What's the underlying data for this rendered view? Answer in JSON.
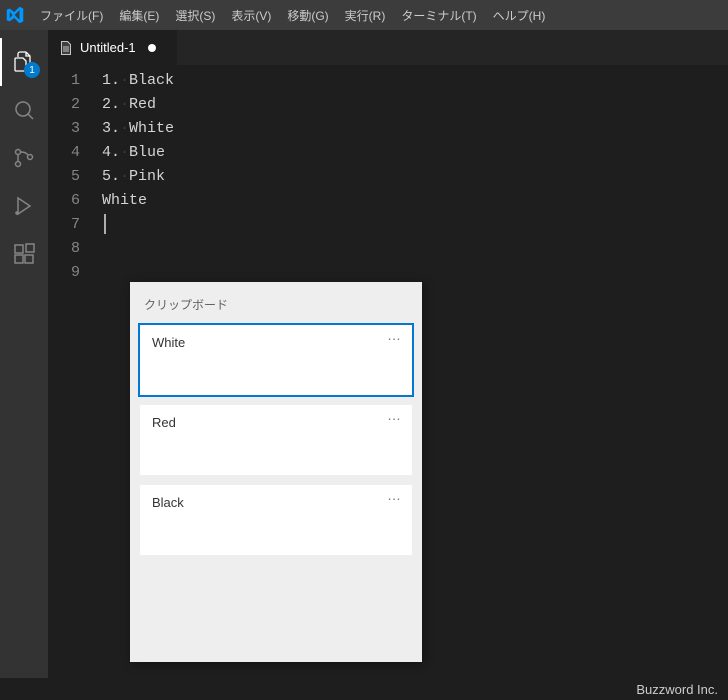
{
  "menu": {
    "file": "ファイル(F)",
    "edit": "編集(E)",
    "select": "選択(S)",
    "view": "表示(V)",
    "go": "移動(G)",
    "run": "実行(R)",
    "terminal": "ターミナル(T)",
    "help": "ヘルプ(H)"
  },
  "activity": {
    "explorer_badge": "1"
  },
  "tab": {
    "title": "Untitled-1"
  },
  "gutter": {
    "l1": "1",
    "l2": "2",
    "l3": "3",
    "l4": "4",
    "l5": "5",
    "l6": "6",
    "l7": "7",
    "l8": "8",
    "l9": "9"
  },
  "code": {
    "l1": "",
    "l2a": "1.",
    "l2b": "Black",
    "l3a": "2.",
    "l3b": "Red",
    "l4a": "3.",
    "l4b": "White",
    "l5a": "4.",
    "l5b": "Blue",
    "l6a": "5.",
    "l6b": "Pink",
    "l7": "",
    "l8": "White",
    "l9": ""
  },
  "clipboard": {
    "title": "クリップボード",
    "item1": "White",
    "item2": "Red",
    "item3": "Black",
    "more": "…"
  },
  "status": {
    "attribution": "Buzzword Inc."
  }
}
